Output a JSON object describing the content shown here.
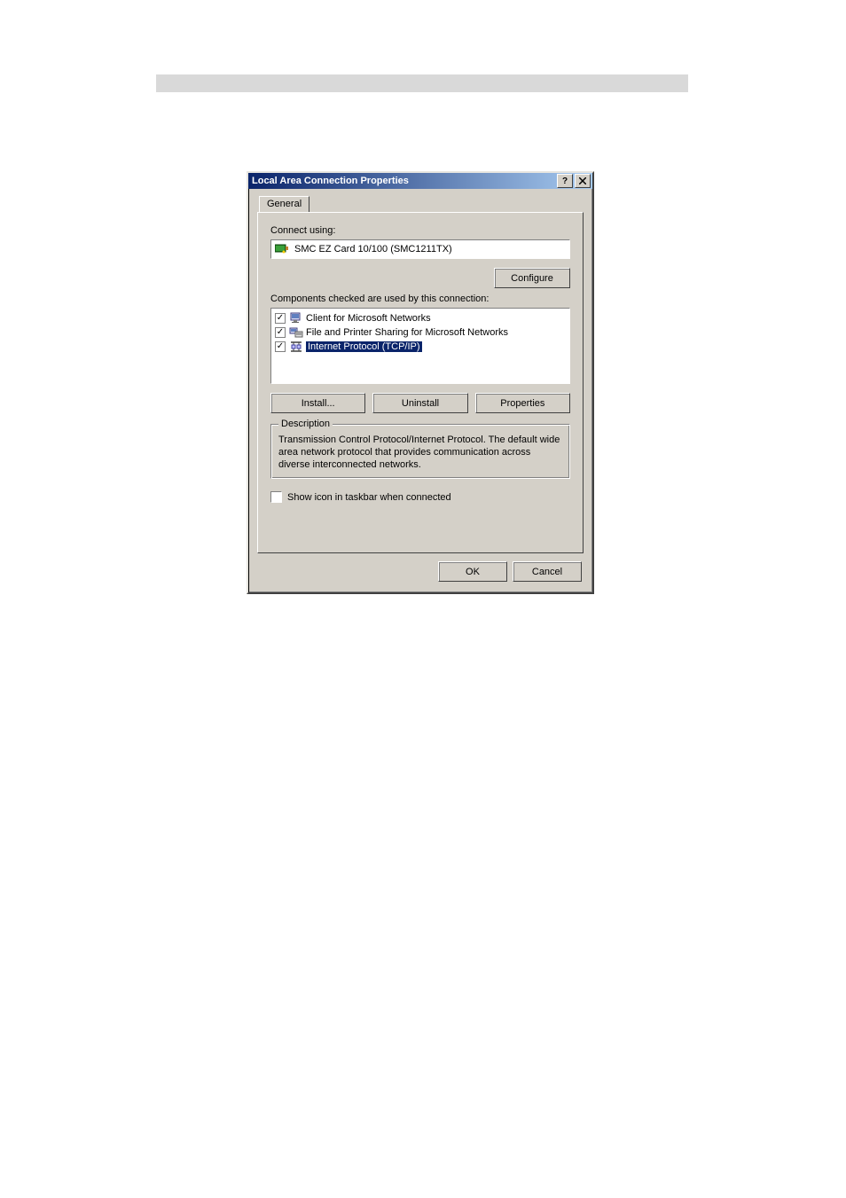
{
  "dialog": {
    "title": "Local Area Connection Properties",
    "tab_general": "General",
    "connect_using_label": "Connect using:",
    "adapter_name": "SMC EZ Card 10/100 (SMC1211TX)",
    "configure_btn": "Configure",
    "components_label": "Components checked are used by this connection:",
    "components": [
      {
        "label": "Client for Microsoft Networks",
        "checked": true,
        "selected": false,
        "icon": "client"
      },
      {
        "label": "File and Printer Sharing for Microsoft Networks",
        "checked": true,
        "selected": false,
        "icon": "service"
      },
      {
        "label": "Internet Protocol (TCP/IP)",
        "checked": true,
        "selected": true,
        "icon": "protocol"
      }
    ],
    "install_btn": "Install...",
    "uninstall_btn": "Uninstall",
    "properties_btn": "Properties",
    "description_legend": "Description",
    "description_text": "Transmission Control Protocol/Internet Protocol. The default wide area network protocol that provides communication across diverse interconnected networks.",
    "show_icon_label": "Show icon in taskbar when connected",
    "show_icon_checked": false,
    "ok_btn": "OK",
    "cancel_btn": "Cancel"
  }
}
